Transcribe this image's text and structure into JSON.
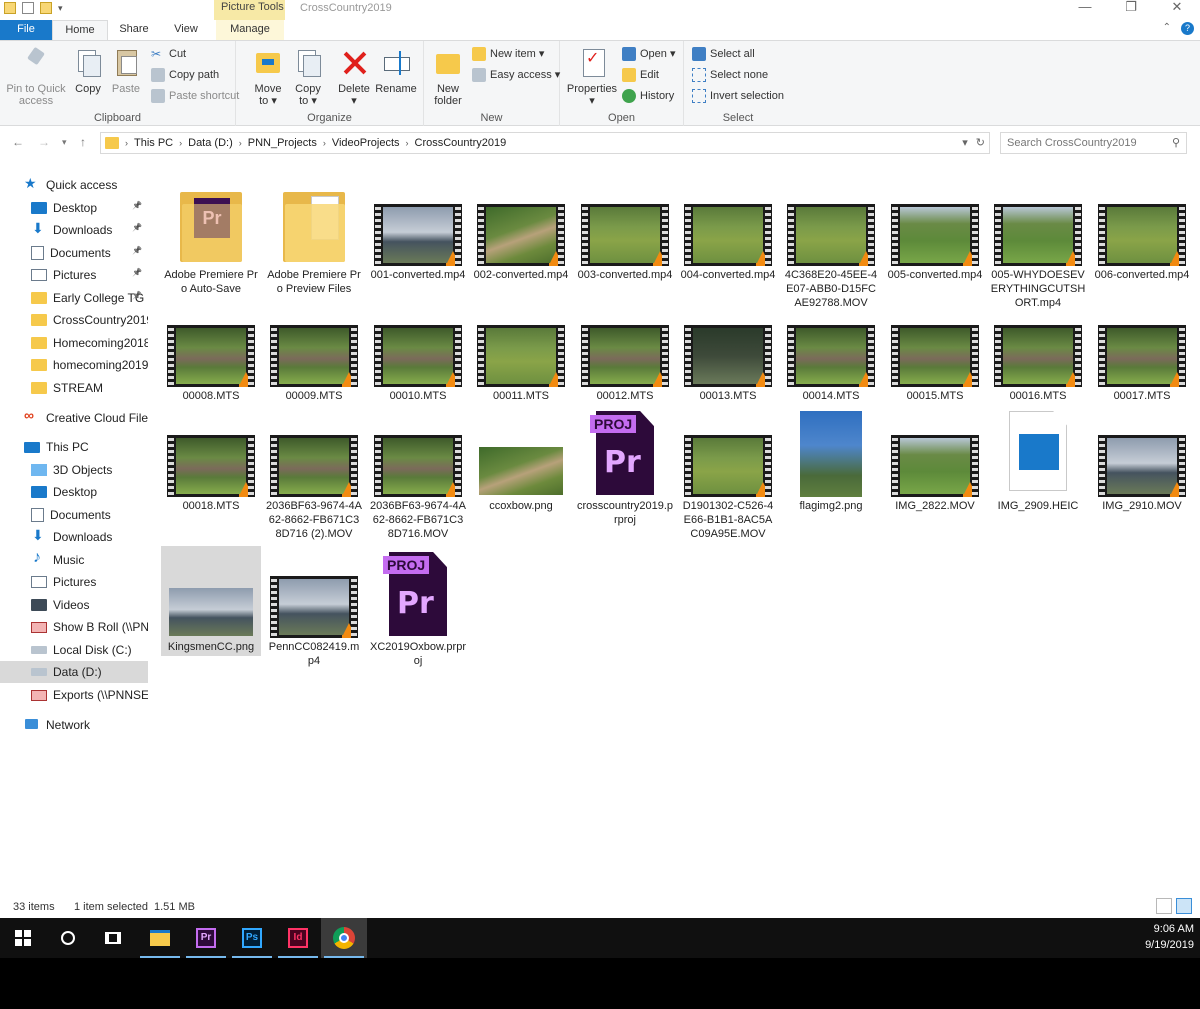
{
  "window": {
    "title": "CrossCountry2019",
    "picture_tools": "Picture Tools"
  },
  "tabs": [
    "File",
    "Home",
    "Share",
    "View",
    "Manage"
  ],
  "ribbon": {
    "clipboard": {
      "label": "Clipboard",
      "pin": [
        "Pin to Quick",
        "access"
      ],
      "copy": "Copy",
      "paste": "Paste",
      "cut": "Cut",
      "copy_path": "Copy path",
      "paste_shortcut": "Paste shortcut"
    },
    "organize": {
      "label": "Organize",
      "move_to": [
        "Move",
        "to ▾"
      ],
      "copy_to": [
        "Copy",
        "to ▾"
      ],
      "delete": [
        "Delete",
        "▾"
      ],
      "rename": "Rename"
    },
    "new": {
      "label": "New",
      "new_folder": [
        "New",
        "folder"
      ],
      "new_item": "New item ▾",
      "easy_access": "Easy access ▾"
    },
    "open": {
      "label": "Open",
      "properties": [
        "Properties",
        "▾"
      ],
      "open": "Open ▾",
      "edit": "Edit",
      "history": "History"
    },
    "select": {
      "label": "Select",
      "select_all": "Select all",
      "select_none": "Select none",
      "invert": "Invert selection"
    }
  },
  "address": {
    "crumbs": [
      "This PC",
      "Data (D:)",
      "PNN_Projects",
      "VideoProjects",
      "CrossCountry2019"
    ],
    "search_placeholder": "Search CrossCountry2019"
  },
  "sidebar": [
    {
      "label": "Quick access",
      "icon": "star",
      "pinned": false
    },
    {
      "label": "Desktop",
      "icon": "desk",
      "pinned": true
    },
    {
      "label": "Downloads",
      "icon": "down",
      "pinned": true
    },
    {
      "label": "Documents",
      "icon": "doc",
      "pinned": true
    },
    {
      "label": "Pictures",
      "icon": "pic",
      "pinned": true
    },
    {
      "label": "Early College TG",
      "icon": "folder",
      "pinned": true
    },
    {
      "label": "CrossCountry2019",
      "icon": "folder",
      "pinned": false
    },
    {
      "label": "Homecoming2018",
      "icon": "folder",
      "pinned": false
    },
    {
      "label": "homecoming2019",
      "icon": "folder",
      "pinned": false
    },
    {
      "label": "STREAM",
      "icon": "folder",
      "pinned": false
    },
    {
      "label": "Creative Cloud Files",
      "icon": "cloud",
      "pinned": false
    },
    {
      "label": "This PC",
      "icon": "pc",
      "pinned": false
    },
    {
      "label": "3D Objects",
      "icon": "3d",
      "pinned": false
    },
    {
      "label": "Desktop",
      "icon": "desk",
      "pinned": false
    },
    {
      "label": "Documents",
      "icon": "doc",
      "pinned": false
    },
    {
      "label": "Downloads",
      "icon": "down",
      "pinned": false
    },
    {
      "label": "Music",
      "icon": "music",
      "pinned": false
    },
    {
      "label": "Pictures",
      "icon": "pic",
      "pinned": false
    },
    {
      "label": "Videos",
      "icon": "video",
      "pinned": false
    },
    {
      "label": "Show B Roll (\\\\PNN",
      "icon": "net",
      "pinned": false
    },
    {
      "label": "Local Disk (C:)",
      "icon": "drive",
      "pinned": false
    },
    {
      "label": "Data (D:)",
      "icon": "drive",
      "pinned": false
    },
    {
      "label": "Exports (\\\\PNNSERV",
      "icon": "net",
      "pinned": false
    },
    {
      "label": "Network",
      "icon": "netw",
      "pinned": false
    }
  ],
  "files": [
    {
      "name": "Adobe Premiere Pro Auto-Save",
      "type": "folder-pr"
    },
    {
      "name": "Adobe Premiere Pro Preview Files",
      "type": "folder-doc"
    },
    {
      "name": "001-converted.mp4",
      "type": "video",
      "img": "sky"
    },
    {
      "name": "002-converted.mp4",
      "type": "video",
      "img": "path"
    },
    {
      "name": "003-converted.mp4",
      "type": "video",
      "img": "field"
    },
    {
      "name": "004-converted.mp4",
      "type": "video",
      "img": "field"
    },
    {
      "name": "4C368E20-45EE-4E07-ABB0-D15FCAE92788.MOV",
      "type": "video",
      "img": "field"
    },
    {
      "name": "005-converted.mp4",
      "type": "video",
      "img": "trees"
    },
    {
      "name": "005-WHYDOESEVERYTHINGCUTSHORT.mp4",
      "type": "video",
      "img": "trees"
    },
    {
      "name": "006-converted.mp4",
      "type": "video",
      "img": "field"
    },
    {
      "name": "00008.MTS",
      "type": "video",
      "img": "crowd"
    },
    {
      "name": "00009.MTS",
      "type": "video",
      "img": "crowd"
    },
    {
      "name": "00010.MTS",
      "type": "video",
      "img": "crowd"
    },
    {
      "name": "00011.MTS",
      "type": "video",
      "img": "field"
    },
    {
      "name": "00012.MTS",
      "type": "video",
      "img": "crowd"
    },
    {
      "name": "00013.MTS",
      "type": "video",
      "img": "dark"
    },
    {
      "name": "00014.MTS",
      "type": "video",
      "img": "crowd"
    },
    {
      "name": "00015.MTS",
      "type": "video",
      "img": "crowd"
    },
    {
      "name": "00016.MTS",
      "type": "video",
      "img": "crowd"
    },
    {
      "name": "00017.MTS",
      "type": "video",
      "img": "crowd"
    },
    {
      "name": "00018.MTS",
      "type": "video",
      "img": "crowd"
    },
    {
      "name": "2036BF63-9674-4A62-8662-FB671C38D716 (2).MOV",
      "type": "video",
      "img": "crowd"
    },
    {
      "name": "2036BF63-9674-4A62-8662-FB671C38D716.MOV",
      "type": "video",
      "img": "crowd"
    },
    {
      "name": "ccoxbow.png",
      "type": "image",
      "img": "path"
    },
    {
      "name": "crosscountry2019.prproj",
      "type": "prproj"
    },
    {
      "name": "D1901302-C526-4E66-B1B1-8AC5AC09A95E.MOV",
      "type": "video",
      "img": "field"
    },
    {
      "name": "flagimg2.png",
      "type": "portrait",
      "img": "flag"
    },
    {
      "name": "IMG_2822.MOV",
      "type": "video",
      "img": "trees"
    },
    {
      "name": "IMG_2909.HEIC",
      "type": "heic"
    },
    {
      "name": "IMG_2910.MOV",
      "type": "video",
      "img": "sky"
    },
    {
      "name": "KingsmenCC.png",
      "type": "image",
      "img": "sky",
      "selected": true
    },
    {
      "name": "PennCC082419.mp4",
      "type": "video",
      "img": "sky"
    },
    {
      "name": "XC2019Oxbow.prproj",
      "type": "prproj"
    }
  ],
  "pr_tag": "PROJ",
  "pr_text": "Pr",
  "status": {
    "count": "33 items",
    "selected": "1 item selected",
    "size": "1.51 MB"
  },
  "taskbar": {
    "time": "9:06 AM",
    "date": "9/19/2019",
    "apps": [
      "Pr",
      "Ps",
      "Id"
    ]
  }
}
